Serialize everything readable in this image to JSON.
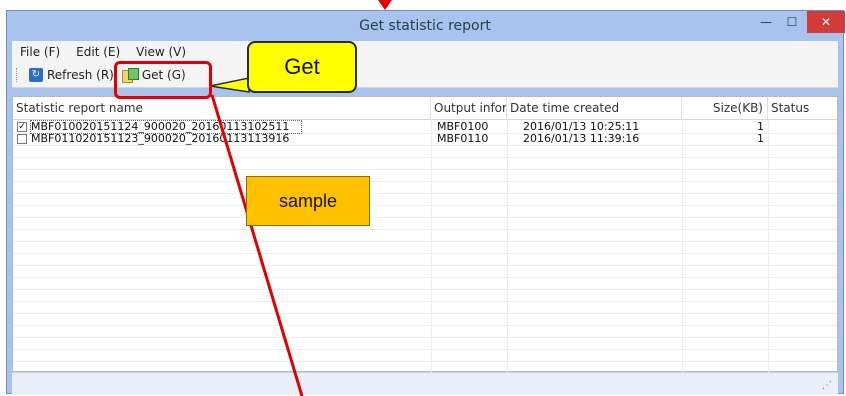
{
  "window": {
    "title": "Get statistic report",
    "controls": {
      "minimize": "—",
      "maximize": "☐",
      "close": "✕"
    }
  },
  "menubar": {
    "items": [
      {
        "label": "File (F)"
      },
      {
        "label": "Edit (E)"
      },
      {
        "label": "View (V)"
      }
    ]
  },
  "toolbar": {
    "refresh_label": "Refresh (R)",
    "get_label": "Get (G)",
    "refresh_icon": "refresh-icon",
    "get_icon": "get-report-icon"
  },
  "table": {
    "columns": [
      {
        "label": "Statistic report name"
      },
      {
        "label": "Output infor..."
      },
      {
        "label": "Date time created"
      },
      {
        "label": "Size(KB)"
      },
      {
        "label": "Status"
      }
    ],
    "rows": [
      {
        "checked": true,
        "name": "MBF010020151124_900020_20160113102511",
        "output": "MBF0100",
        "date": "2016/01/13 10:25:11",
        "size": "1",
        "status": ""
      },
      {
        "checked": false,
        "name": "MBF011020151123_900020_20160113113916",
        "output": "MBF0110",
        "date": "2016/01/13 11:39:16",
        "size": "1",
        "status": ""
      }
    ]
  },
  "annotations": {
    "callout_label": "Get",
    "sample_label": "sample"
  },
  "colors": {
    "callout_fill": "#ffff00",
    "highlight": "#e00000",
    "sample_fill": "#ffc000",
    "titlebar": "#a8c4ee"
  }
}
